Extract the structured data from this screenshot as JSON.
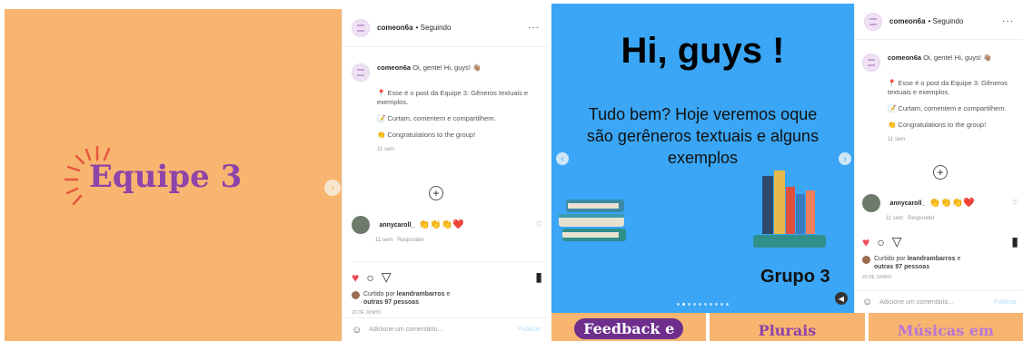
{
  "left_post": {
    "image_title": "Equipe 3",
    "username": "comeon6a",
    "following": "• Seguindo",
    "caption_intro": "Oi, gente! Hi, guys! 👋🏽",
    "caption_p1": "📍 Esse é o post da Equipe 3: Gêneros textuais e exemplos.",
    "caption_p2": "📝 Curtam, comentem e compartilhem.",
    "caption_p3": "👏 Congratulations to the group!",
    "caption_time": "11 sem",
    "commenter": "annycaroll_",
    "comment_text": "👏👏👏❤️",
    "comment_time": "11 sem",
    "reply": "Responder",
    "liked_by_prefix": "Curtido por",
    "liked_by_user": "leandrambarros",
    "liked_by_suffix": "e",
    "liked_others": "outras 97 pessoas",
    "date": "20 DE JUNHO",
    "add_comment_placeholder": "Adicione um comentário...",
    "publish": "Publicar"
  },
  "right_post": {
    "image_title": "Hi, guys !",
    "image_sub_line1": "Tudo bem? Hoje veremos oque",
    "image_sub_line2": "são gerêneros textuais e alguns",
    "image_sub_line3": "exemplos",
    "group_label": "Grupo 3",
    "username": "comeon6a",
    "following": "• Seguindo",
    "caption_intro": "Oi, gente! Hi, guys! 👋🏽",
    "caption_p1": "📍 Esse é o post da Equipe 3: Gêneros textuais e exemplos.",
    "caption_p2": "📝 Curtam, comentem e compartilhem.",
    "caption_p3": "👏 Congratulations to the group!",
    "caption_time": "11 sem",
    "commenter": "annycaroll_",
    "comment_text": "👏👏👏❤️",
    "comment_time": "11 sem",
    "reply": "Responder",
    "liked_by_prefix": "Curtido por",
    "liked_by_user": "leandrambarros",
    "liked_by_suffix": "e",
    "liked_others": "outras 97 pessoas",
    "date": "20 DE JUNHO",
    "add_comment_placeholder": "Adicione um comentário...",
    "publish": "Publicar"
  },
  "bottom_strip": {
    "tile1": "Feedback e",
    "tile2": "Plurais",
    "tile3": "Músicas em"
  },
  "colors": {
    "orange": "#f7b56f",
    "purple": "#8e44a8",
    "blue": "#3aa6f5",
    "like_red": "#ed4956"
  },
  "icons": [
    "heart-icon",
    "comment-icon",
    "share-icon",
    "bookmark-icon",
    "plus-circle-icon",
    "smile-icon",
    "more-icon",
    "next-arrow-icon",
    "prev-arrow-icon",
    "speaker-icon"
  ]
}
